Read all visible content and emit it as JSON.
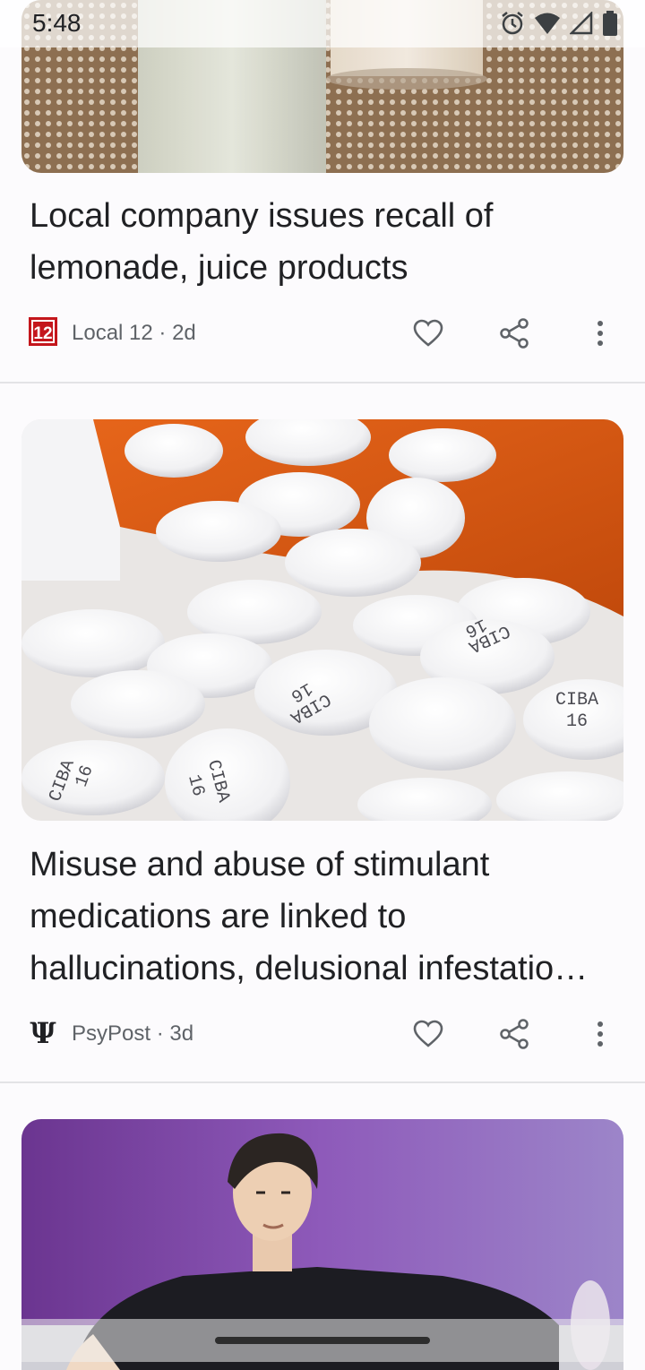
{
  "status_bar": {
    "time": "5:48"
  },
  "articles": [
    {
      "title": "Local company issues recall of lemonade, juice products",
      "source": "Local 12 · 2d",
      "logo_text": "12"
    },
    {
      "title": "Misuse and abuse of stimulant medications are linked to hallucinations, delusional infestatio…",
      "source": "PsyPost · 3d",
      "logo_text": "Ψ",
      "pill_labels": [
        "CIBA",
        "16"
      ]
    }
  ],
  "colors": {
    "accent_red": "#c4161c",
    "text_secondary": "#5f6368",
    "icon": "#5f6368"
  }
}
